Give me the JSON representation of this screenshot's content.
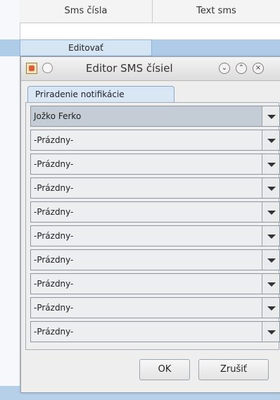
{
  "table": {
    "columns": [
      "Sms čísla",
      "Text sms"
    ],
    "editing_cell": "Editovať"
  },
  "dialog": {
    "title": "Editor SMS čísiel",
    "tab_label": "Priradenie notifikácie",
    "combos": [
      "Jožko Ferko",
      "-Prázdny-",
      "-Prázdny-",
      "-Prázdny-",
      "-Prázdny-",
      "-Prázdny-",
      "-Prázdny-",
      "-Prázdny-",
      "-Prázdny-",
      "-Prázdny-"
    ],
    "ok_label": "OK",
    "cancel_label": "Zrušiť"
  }
}
